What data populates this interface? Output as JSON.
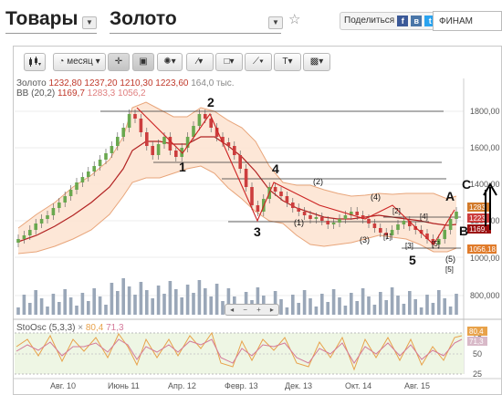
{
  "header": {
    "title_commodities": "Товары",
    "title_instrument": "Золото",
    "share_label": "Поделиться",
    "search_placeholder": "ФИНАМ"
  },
  "toolbar": {
    "period_label": "месяц",
    "tool_text_label": "T"
  },
  "legend": {
    "instrument_name": "Золото",
    "ohlc": [
      "1232,80",
      "1237,20",
      "1210,30",
      "1223,60"
    ],
    "volume": "164,0 тыс.",
    "bb_label": "BB (20,2)",
    "bb_values": [
      "1169,7",
      "1283,3",
      "1056,2"
    ],
    "stoch_label": "StoOsc (5,3,3)",
    "stoch_values": [
      "80,4",
      "71,3"
    ]
  },
  "axis": {
    "price_ticks": [
      "1800,00",
      "1600,00",
      "1400,00",
      "1200,00",
      "1000,00"
    ],
    "volume_tick": "800,000",
    "stoch_ticks": [
      "75",
      "50",
      "25"
    ],
    "x_ticks": [
      "Авг. 10",
      "Июнь 11",
      "Апр. 12",
      "Февр. 13",
      "Дек. 13",
      "Окт. 14",
      "Авг. 15"
    ],
    "price_labels": [
      "1283",
      "1223",
      "1169,",
      "1056,18"
    ],
    "stoch_current": [
      "80,4",
      "71,3"
    ]
  },
  "annotations": {
    "wave_labels": [
      "1",
      "2",
      "3",
      "4",
      "5",
      "A",
      "B",
      "C"
    ],
    "sub_labels": [
      "(1)",
      "(2)",
      "(3)",
      "(4)",
      "(5)",
      "[1]",
      "[2]",
      "[3]",
      "[4]",
      "[5]",
      "[5]"
    ]
  },
  "colors": {
    "up": "#6aa84f",
    "down": "#cc3d3d",
    "band_fill": "#fde3d0",
    "band_line": "#e8a57a",
    "mid_line": "#b22222",
    "stoch_k": "#e8a24a",
    "stoch_d": "#d47a9a",
    "volume": "#9aa7b8"
  }
}
